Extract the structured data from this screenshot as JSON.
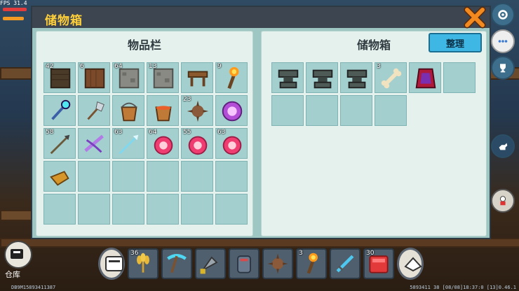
{
  "hud": {
    "fps": "FPS 31.4"
  },
  "window": {
    "title": "储物箱"
  },
  "inventory": {
    "title": "物品栏",
    "slots": [
      {
        "icon": "dark-wood-block-icon",
        "count": "42"
      },
      {
        "icon": "wood-block-icon",
        "count": "6"
      },
      {
        "icon": "stone-block-icon",
        "count": "64"
      },
      {
        "icon": "stone-block-icon",
        "count": "13"
      },
      {
        "icon": "crafting-table-icon",
        "count": ""
      },
      {
        "icon": "torch-icon",
        "count": "9"
      },
      {
        "icon": "magic-wand-icon",
        "count": ""
      },
      {
        "icon": "shovel-icon",
        "count": ""
      },
      {
        "icon": "bucket-icon",
        "count": ""
      },
      {
        "icon": "water-bucket-icon",
        "count": ""
      },
      {
        "icon": "spiked-seed-icon",
        "count": "23"
      },
      {
        "icon": "magic-scroll-icon",
        "count": ""
      },
      {
        "icon": "arrow-icon",
        "count": "58"
      },
      {
        "icon": "crossbow-icon",
        "count": ""
      },
      {
        "icon": "ice-arrow-icon",
        "count": "63"
      },
      {
        "icon": "meat-icon",
        "count": "64"
      },
      {
        "icon": "meat-icon",
        "count": "55"
      },
      {
        "icon": "meat-icon",
        "count": "63"
      },
      {
        "icon": "whistle-icon",
        "count": ""
      },
      {
        "icon": "",
        "count": ""
      },
      {
        "icon": "",
        "count": ""
      },
      {
        "icon": "",
        "count": ""
      },
      {
        "icon": "",
        "count": ""
      },
      {
        "icon": "",
        "count": ""
      },
      {
        "icon": "",
        "count": ""
      },
      {
        "icon": "",
        "count": ""
      },
      {
        "icon": "",
        "count": ""
      },
      {
        "icon": "",
        "count": ""
      },
      {
        "icon": "",
        "count": ""
      },
      {
        "icon": "",
        "count": ""
      }
    ]
  },
  "storage": {
    "title": "储物箱",
    "sort_label": "整理",
    "slots": [
      {
        "icon": "anvil-icon",
        "count": ""
      },
      {
        "icon": "anvil-icon",
        "count": ""
      },
      {
        "icon": "anvil-icon",
        "count": ""
      },
      {
        "icon": "bone-icon",
        "count": "3"
      },
      {
        "icon": "red-cape-icon",
        "count": ""
      },
      {
        "icon": "",
        "count": ""
      },
      {
        "icon": "",
        "count": ""
      },
      {
        "icon": "",
        "count": ""
      },
      {
        "icon": "",
        "count": ""
      },
      {
        "icon": "",
        "count": ""
      }
    ]
  },
  "hotbar": {
    "slots": [
      {
        "icon": "wheat-icon",
        "count": "36"
      },
      {
        "icon": "diamond-pickaxe-icon",
        "count": ""
      },
      {
        "icon": "drill-icon",
        "count": ""
      },
      {
        "icon": "mechanical-glove-icon",
        "count": ""
      },
      {
        "icon": "spiked-seed-icon",
        "count": ""
      },
      {
        "icon": "torch-icon",
        "count": "3"
      },
      {
        "icon": "ice-sword-icon",
        "count": ""
      },
      {
        "icon": "red-block-icon",
        "count": "30"
      }
    ]
  },
  "warehouse": {
    "label": "仓库"
  },
  "footer": {
    "left": "DB9M15893411387",
    "right": "5893411 38   [08/08]18:37:0   [13]0.46.1"
  }
}
